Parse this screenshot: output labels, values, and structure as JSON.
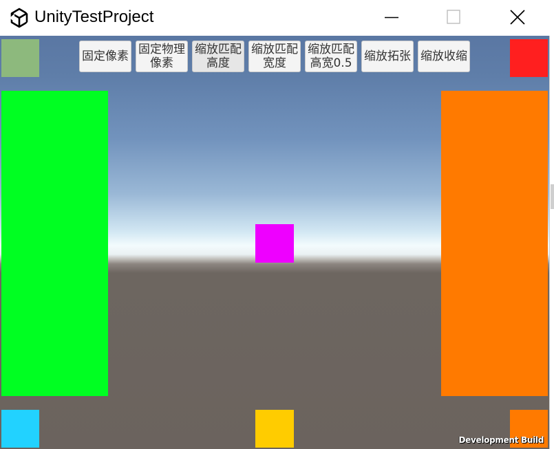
{
  "window": {
    "title": "UnityTestProject",
    "app_icon": "unity-logo-icon",
    "controls": {
      "minimize_icon": "minimize-icon",
      "maximize_icon": "maximize-icon",
      "close_icon": "close-icon"
    }
  },
  "toolbar": {
    "buttons": [
      {
        "line1": "固定像素",
        "line2": ""
      },
      {
        "line1": "固定物理",
        "line2": "像素"
      },
      {
        "line1": "缩放匹配",
        "line2": "高度"
      },
      {
        "line1": "缩放匹配",
        "line2": "宽度"
      },
      {
        "line1": "缩放匹配",
        "line2": "高宽0.5"
      },
      {
        "line1": "缩放拓张",
        "line2": ""
      },
      {
        "line1": "缩放收缩",
        "line2": ""
      }
    ]
  },
  "scene": {
    "colors": {
      "top_left_square": "#8db97d",
      "top_right_square": "#ff1f1f",
      "left_panel": "#00ff22",
      "right_panel": "#ff7a00",
      "center_square": "#ee00ff",
      "bottom_left_square": "#22d2ff",
      "bottom_center_square": "#ffcc00",
      "bottom_right_square": "#ff7a00"
    }
  },
  "footer": {
    "build_label": "Development Build"
  }
}
